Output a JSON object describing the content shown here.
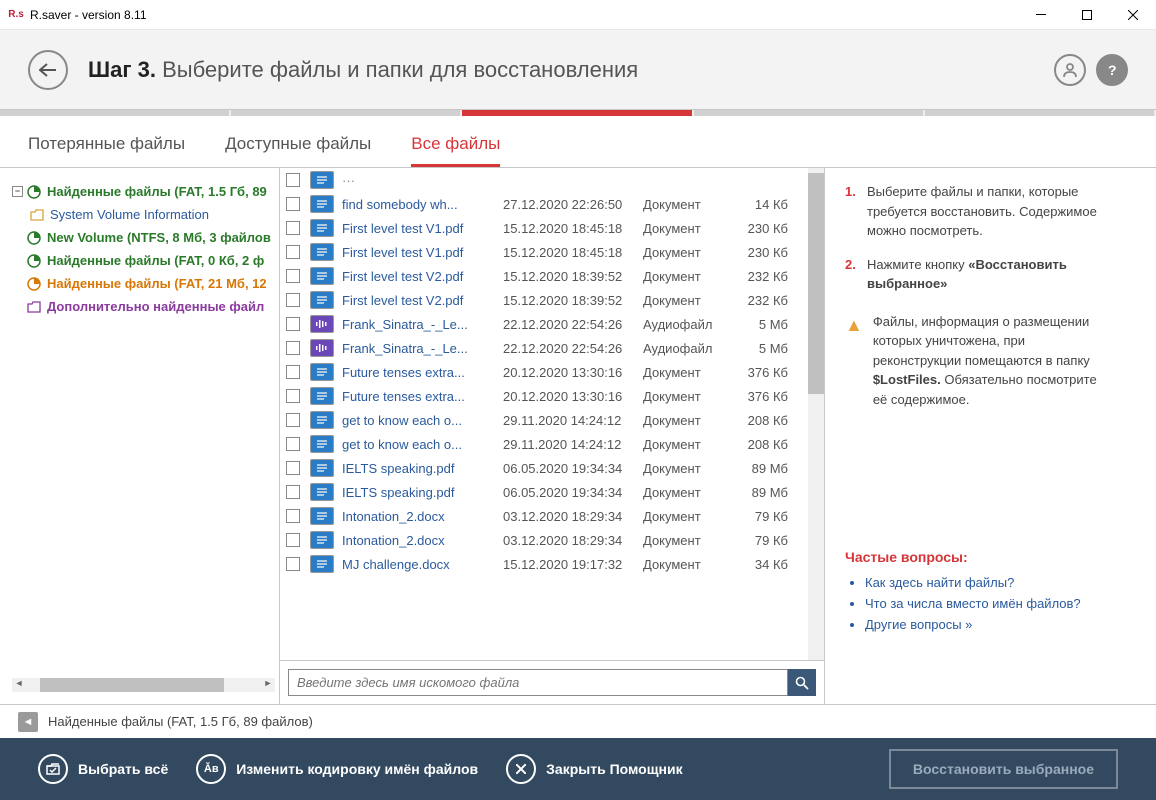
{
  "window": {
    "title": "R.saver - version 8.11"
  },
  "header": {
    "step": "Шаг 3.",
    "subtitle": "Выберите файлы и папки для восстановления"
  },
  "tabs": {
    "lost": "Потерянные файлы",
    "available": "Доступные файлы",
    "all": "Все файлы"
  },
  "tree": {
    "items": [
      {
        "label": "Найденные файлы (FAT, 1.5 Гб, 89",
        "cls": "green",
        "bold": true,
        "toggle": "−",
        "icon": "pie-green"
      },
      {
        "label": "System Volume Information",
        "cls": "link",
        "indent": 1,
        "icon": "folder"
      },
      {
        "label": "New Volume (NTFS, 8 Мб, 3 файлов",
        "cls": "green",
        "bold": true,
        "icon": "pie-green"
      },
      {
        "label": "Найденные файлы (FAT, 0 Кб, 2 ф",
        "cls": "green",
        "bold": true,
        "icon": "pie-green"
      },
      {
        "label": "Найденные файлы (FAT, 21 Мб, 12",
        "cls": "orange",
        "bold": true,
        "icon": "pie-orange"
      },
      {
        "label": "Дополнительно найденные файл",
        "cls": "purple",
        "bold": true,
        "icon": "folder-purple"
      }
    ]
  },
  "files": [
    {
      "name": "find somebody wh...",
      "date": "27.12.2020 22:26:50",
      "type": "Документ",
      "size": "14 Кб",
      "icon": "doc"
    },
    {
      "name": "First level test V1.pdf",
      "date": "15.12.2020 18:45:18",
      "type": "Документ",
      "size": "230 Кб",
      "icon": "doc"
    },
    {
      "name": "First level test V1.pdf",
      "date": "15.12.2020 18:45:18",
      "type": "Документ",
      "size": "230 Кб",
      "icon": "doc"
    },
    {
      "name": "First level test V2.pdf",
      "date": "15.12.2020 18:39:52",
      "type": "Документ",
      "size": "232 Кб",
      "icon": "doc"
    },
    {
      "name": "First level test V2.pdf",
      "date": "15.12.2020 18:39:52",
      "type": "Документ",
      "size": "232 Кб",
      "icon": "doc"
    },
    {
      "name": "Frank_Sinatra_-_Le...",
      "date": "22.12.2020 22:54:26",
      "type": "Аудиофайл",
      "size": "5 Мб",
      "icon": "audio"
    },
    {
      "name": "Frank_Sinatra_-_Le...",
      "date": "22.12.2020 22:54:26",
      "type": "Аудиофайл",
      "size": "5 Мб",
      "icon": "audio"
    },
    {
      "name": "Future tenses extra...",
      "date": "20.12.2020 13:30:16",
      "type": "Документ",
      "size": "376 Кб",
      "icon": "doc"
    },
    {
      "name": "Future tenses extra...",
      "date": "20.12.2020 13:30:16",
      "type": "Документ",
      "size": "376 Кб",
      "icon": "doc"
    },
    {
      "name": "get to know each o...",
      "date": "29.11.2020 14:24:12",
      "type": "Документ",
      "size": "208 Кб",
      "icon": "doc"
    },
    {
      "name": "get to know each o...",
      "date": "29.11.2020 14:24:12",
      "type": "Документ",
      "size": "208 Кб",
      "icon": "doc"
    },
    {
      "name": "IELTS speaking.pdf",
      "date": "06.05.2020 19:34:34",
      "type": "Документ",
      "size": "89 Мб",
      "icon": "doc"
    },
    {
      "name": "IELTS speaking.pdf",
      "date": "06.05.2020 19:34:34",
      "type": "Документ",
      "size": "89 Мб",
      "icon": "doc"
    },
    {
      "name": "Intonation_2.docx",
      "date": "03.12.2020 18:29:34",
      "type": "Документ",
      "size": "79 Кб",
      "icon": "doc"
    },
    {
      "name": "Intonation_2.docx",
      "date": "03.12.2020 18:29:34",
      "type": "Документ",
      "size": "79 Кб",
      "icon": "doc"
    },
    {
      "name": "MJ challenge.docx",
      "date": "15.12.2020 19:17:32",
      "type": "Документ",
      "size": "34 Кб",
      "icon": "doc"
    }
  ],
  "search": {
    "placeholder": "Введите здесь имя искомого файла"
  },
  "side": {
    "step1": "Выберите файлы и папки, которые требуется восстановить. Содержимое можно посмотреть.",
    "step2_a": "Нажмите кнопку ",
    "step2_b": "«Восстановить выбранное»",
    "warn_a": "Файлы, информация о размещении которых уничтожена, при реконструкции помещаются в папку ",
    "warn_b": "$LostFiles.",
    "warn_c": " Обязательно посмотрите её содержимое.",
    "faq_title": "Частые вопросы:",
    "faq": [
      "Как здесь найти файлы?",
      "Что за числа вместо имён файлов?",
      "Другие вопросы »"
    ]
  },
  "breadcrumb": {
    "text": "Найденные файлы (FAT, 1.5 Гб, 89 файлов)"
  },
  "footer": {
    "select_all": "Выбрать всё",
    "encoding": "Изменить кодировку имён файлов",
    "close": "Закрыть Помощник",
    "restore": "Восстановить выбранное"
  }
}
